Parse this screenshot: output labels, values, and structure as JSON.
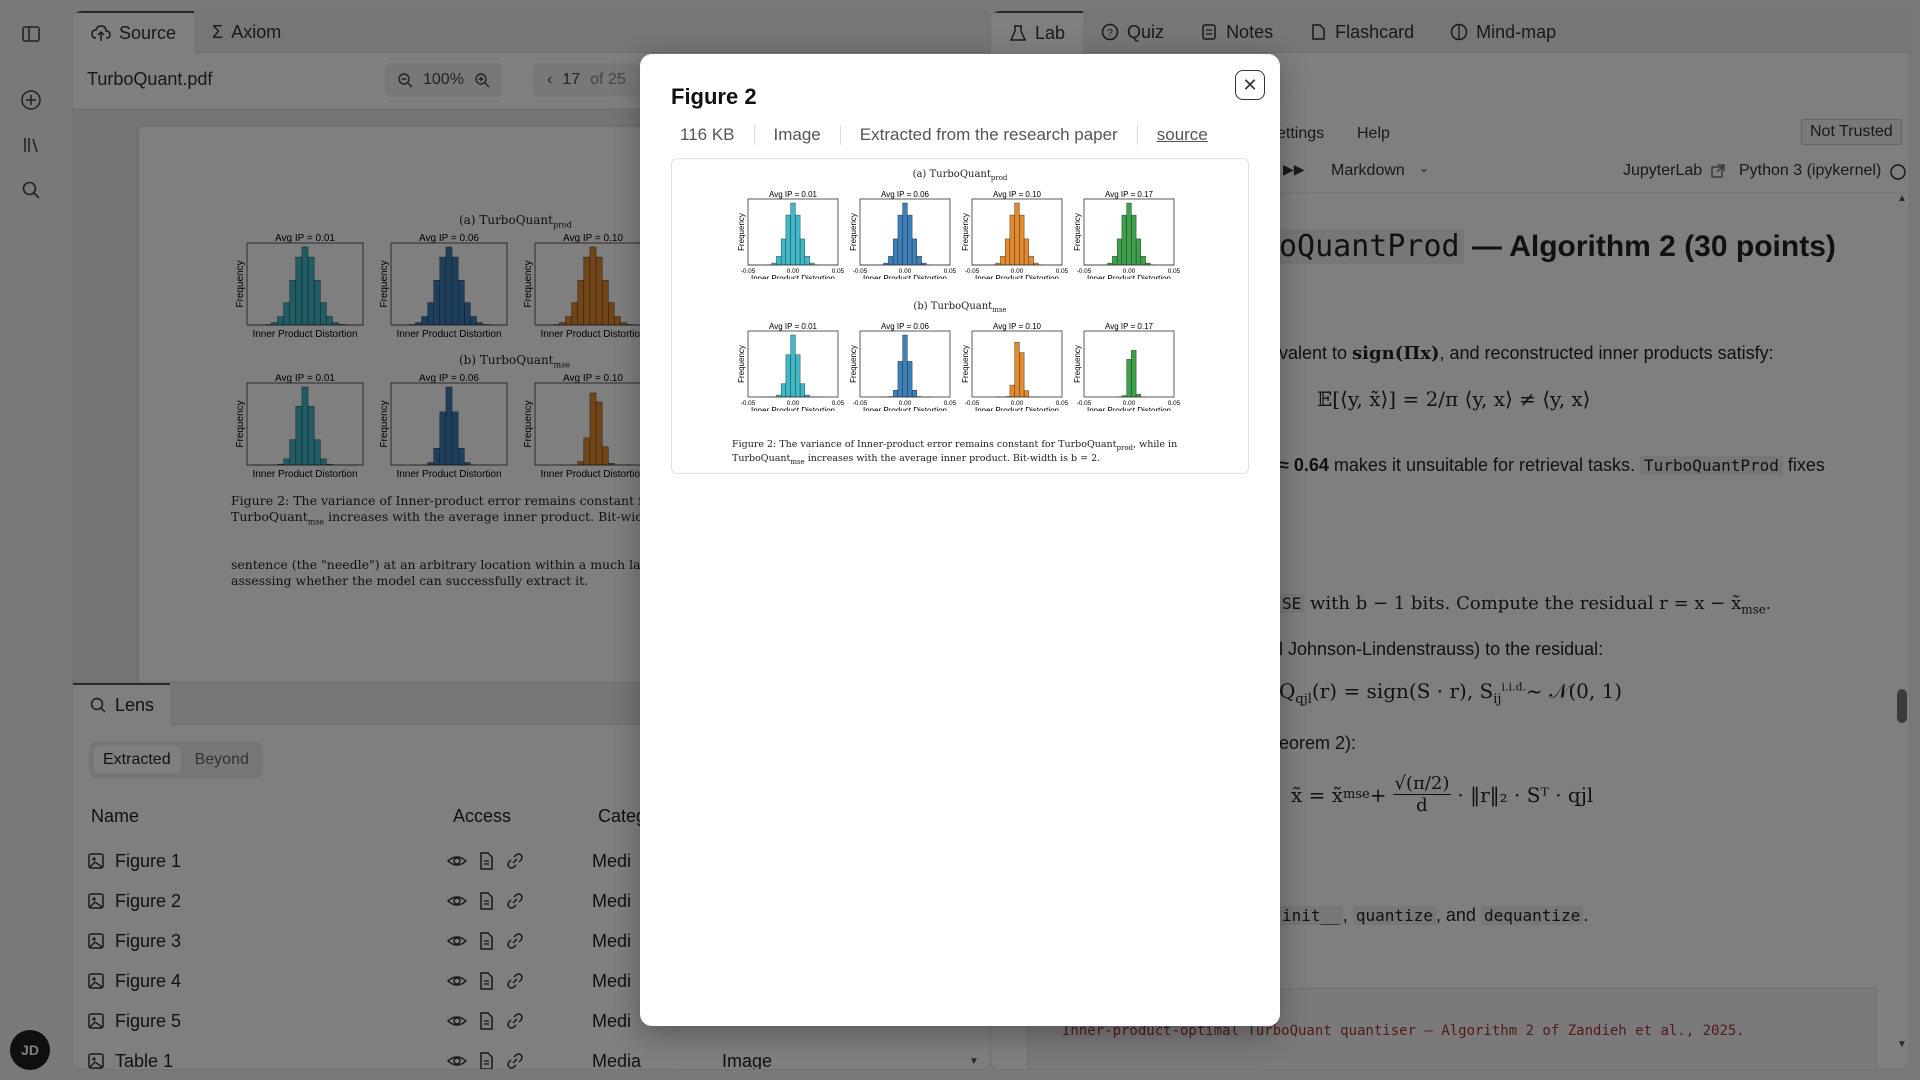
{
  "rail": {
    "avatar_initials": "JD"
  },
  "left": {
    "tabs": [
      {
        "label": "Source",
        "icon": "cloud-upload-icon"
      },
      {
        "label": "Axiom",
        "icon": "sigma-icon"
      }
    ],
    "filename": "TurboQuant.pdf",
    "zoom": "100%",
    "page_current": "17",
    "page_of": "of 25",
    "pdf": {
      "caption_line1": "Figure 2: The variance of Inner-product error remains constant for",
      "caption_line2": "TurboQuant",
      "caption_line2_sub": "mse",
      "caption_line2_rest": " increases with the average inner product. Bit-width",
      "para_line1": "sentence (the \"needle\") at an arbitrary location within a much larg",
      "para_line2": "assessing whether the model can successfully extract it.",
      "sub_a": "(a) TurboQuant",
      "sub_a_sub": "prod",
      "sub_b": "(b) TurboQuant",
      "sub_b_sub": "mse",
      "panel_titles": [
        "Avg IP = 0.01",
        "Avg IP = 0.06",
        "Avg IP = 0.10"
      ],
      "xlabel": "Inner Product Distortion",
      "ylabel": "Frequency"
    },
    "lens": {
      "tab_label": "Lens",
      "seg": [
        "Extracted",
        "Beyond"
      ],
      "col_name": "Name",
      "col_access": "Access",
      "col_category": "Categ",
      "rows": [
        {
          "name": "Figure 1",
          "category": "Medi",
          "type": ""
        },
        {
          "name": "Figure 2",
          "category": "Medi",
          "type": ""
        },
        {
          "name": "Figure 3",
          "category": "Medi",
          "type": ""
        },
        {
          "name": "Figure 4",
          "category": "Medi",
          "type": ""
        },
        {
          "name": "Figure 5",
          "category": "Medi",
          "type": ""
        },
        {
          "name": "Table 1",
          "category": "Media",
          "type": "Image"
        }
      ]
    }
  },
  "right": {
    "tabs": [
      {
        "label": "Lab",
        "icon": "flask-icon"
      },
      {
        "label": "Quiz",
        "icon": "question-circle-icon"
      },
      {
        "label": "Notes",
        "icon": "notes-icon"
      },
      {
        "label": "Flashcard",
        "icon": "card-icon"
      },
      {
        "label": "Mind-map",
        "icon": "brain-icon"
      }
    ],
    "menu": [
      "ettings",
      "Help"
    ],
    "trust": "Not Trusted",
    "cell_type": "Markdown",
    "jupyterlab": "JupyterLab",
    "kernel": "Python 3 (ipykernel)",
    "heading_code": "oQuantProd",
    "heading_rest": "— Algorithm 2 (30 points)",
    "line1_pre": "valent to ",
    "line1_math": "sign(Πx)",
    "line1_post": ", and reconstructed inner products satisfy:",
    "eq1": "𝔼[⟨y, x̃⟩] = 2/π ⟨y, x⟩ ≠ ⟨y, x⟩",
    "line2_pre": "≈ 0.64",
    "line2_mid": " makes it unsuitable for retrieval tasks. ",
    "line2_code": "TurboQuantProd",
    "line2_post": " fixes",
    "line3_code": "SE",
    "line3_text": " with b − 1 bits. Compute the residual r = x − x̃",
    "line3_sub": "mse",
    "line3_end": ".",
    "line4": "l Johnson-Lindenstrauss) to the residual:",
    "eq2": "Q",
    "eq2_sub": "qjl",
    "eq2_rest": "(r) = sign(S · r),    S",
    "eq2_ij": "ij",
    "eq2_iid": "i.i.d.",
    "eq2_end": "~ 𝒩(0, 1)",
    "line5": "eorem 2):",
    "eq3_a": "x̃ = x̃",
    "eq3_sub": "mse",
    "eq3_b": " + ",
    "eq3_frac_num": "√(π/2)",
    "eq3_frac_den": "d",
    "eq3_c": " · ‖r‖₂ · Sᵀ · qjl",
    "line6_code1": "init__",
    "line6_sep": ",",
    "line6_code2": "quantize",
    "line6_and": ", and",
    "line6_code3": "dequantize",
    "line6_end": ".",
    "code_comment": "Inner-product-optimal TurboQuant quantiser — Algorithm 2 of Zandieh et al., 2025."
  },
  "modal": {
    "title": "Figure 2",
    "meta": [
      "116 KB",
      "Image",
      "Extracted from the research paper",
      "source"
    ],
    "figure": {
      "sub_a": "(a) TurboQuant",
      "sub_a_sub": "prod",
      "sub_b": "(b) TurboQuant",
      "sub_b_sub": "mse",
      "panel_titles": [
        "Avg IP = 0.01",
        "Avg IP = 0.06",
        "Avg IP = 0.10",
        "Avg IP = 0.17"
      ],
      "xlabel": "Inner Product Distortion",
      "ylabel": "Frequency",
      "xticks": [
        "-0.05",
        "0.00",
        "0.05"
      ],
      "caption1": "Figure 2: The variance of Inner-product error remains constant for TurboQuant",
      "caption1_sub": "prod",
      "caption1_rest": ", while in",
      "caption2": "TurboQuant",
      "caption2_sub": "mse",
      "caption2_rest": " increases with the average inner product. Bit-width is b = 2.",
      "colors": [
        "#3fb8c9",
        "#3d7fb8",
        "#e48a2e",
        "#3da04a"
      ]
    }
  }
}
